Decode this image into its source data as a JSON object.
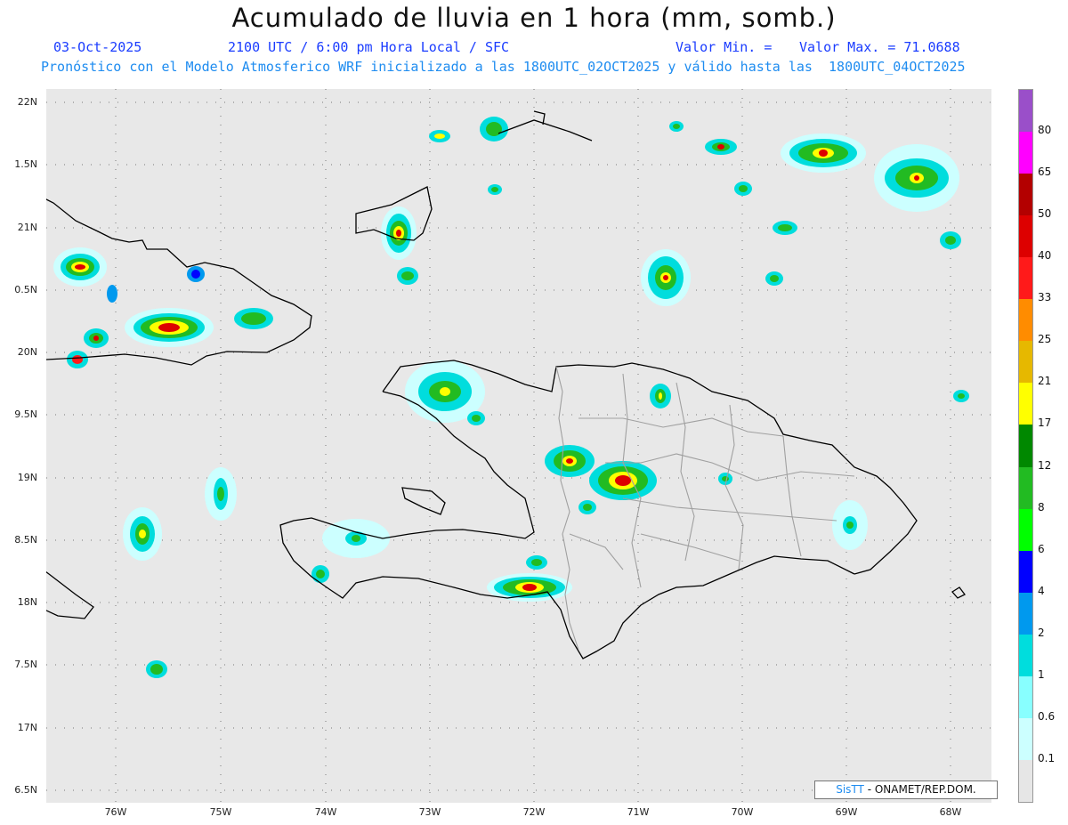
{
  "header": {
    "title": "Acumulado de lluvia en 1 hora (mm, somb.)",
    "date": "03-Oct-2025",
    "time": "2100 UTC / 6:00 pm Hora Local / SFC",
    "min_label": "Valor Min. =",
    "max_label": "Valor Max. = 71.0688",
    "description": "Pronóstico con el Modelo Atmosferico WRF inicializado a las 1800UTC_02OCT2025 y válido hasta las  1800UTC_04OCT2025"
  },
  "axes": {
    "lat_labels": [
      "22N",
      "1.5N",
      "21N",
      "0.5N",
      "20N",
      "9.5N",
      "19N",
      "8.5N",
      "18N",
      "7.5N",
      "17N",
      "6.5N"
    ],
    "lon_labels": [
      "76W",
      "75W",
      "74W",
      "73W",
      "72W",
      "71W",
      "70W",
      "69W",
      "68W"
    ]
  },
  "colorbar": {
    "labels": [
      "80",
      "65",
      "50",
      "40",
      "33",
      "25",
      "21",
      "17",
      "12",
      "8",
      "6",
      "4",
      "2",
      "1",
      "0.6",
      "0.1"
    ],
    "colors": [
      "#9a4fc9",
      "#ff00ff",
      "#b30000",
      "#dd0000",
      "#ff1a1a",
      "#ff8c00",
      "#e6b800",
      "#ffff00",
      "#008800",
      "#22bb22",
      "#00ff00",
      "#0000ff",
      "#0099ee",
      "#00dddd",
      "#88ffff",
      "#ccffff",
      "#e6e6e6"
    ]
  },
  "credit": {
    "logo": "SisTT",
    "text": " - ONAMET/REP.DOM."
  }
}
